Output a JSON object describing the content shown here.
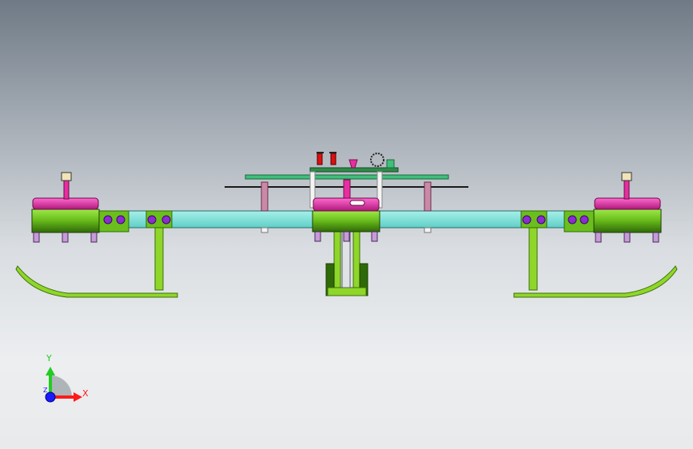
{
  "triad": {
    "x_label": "X",
    "y_label": "Y",
    "z_label": "Z",
    "x_color": "#ff1a1a",
    "y_color": "#22cc22",
    "z_color": "#1a1aff"
  },
  "colors": {
    "arm": "#7fe0d8",
    "frame": "#8fd62a",
    "frame_dark": "#5a9a10",
    "motor": "#6bbf1c",
    "motor_dark": "#2f6a08",
    "motor_top": "#e62ea0",
    "bolt": "#c79bd8",
    "nut": "#8a2ccf",
    "plate": "#3fbf7a",
    "standoff": "#c98aa8"
  },
  "icons": {
    "triad": "coordinate-triad-icon",
    "view": "orthographic-front-view"
  }
}
